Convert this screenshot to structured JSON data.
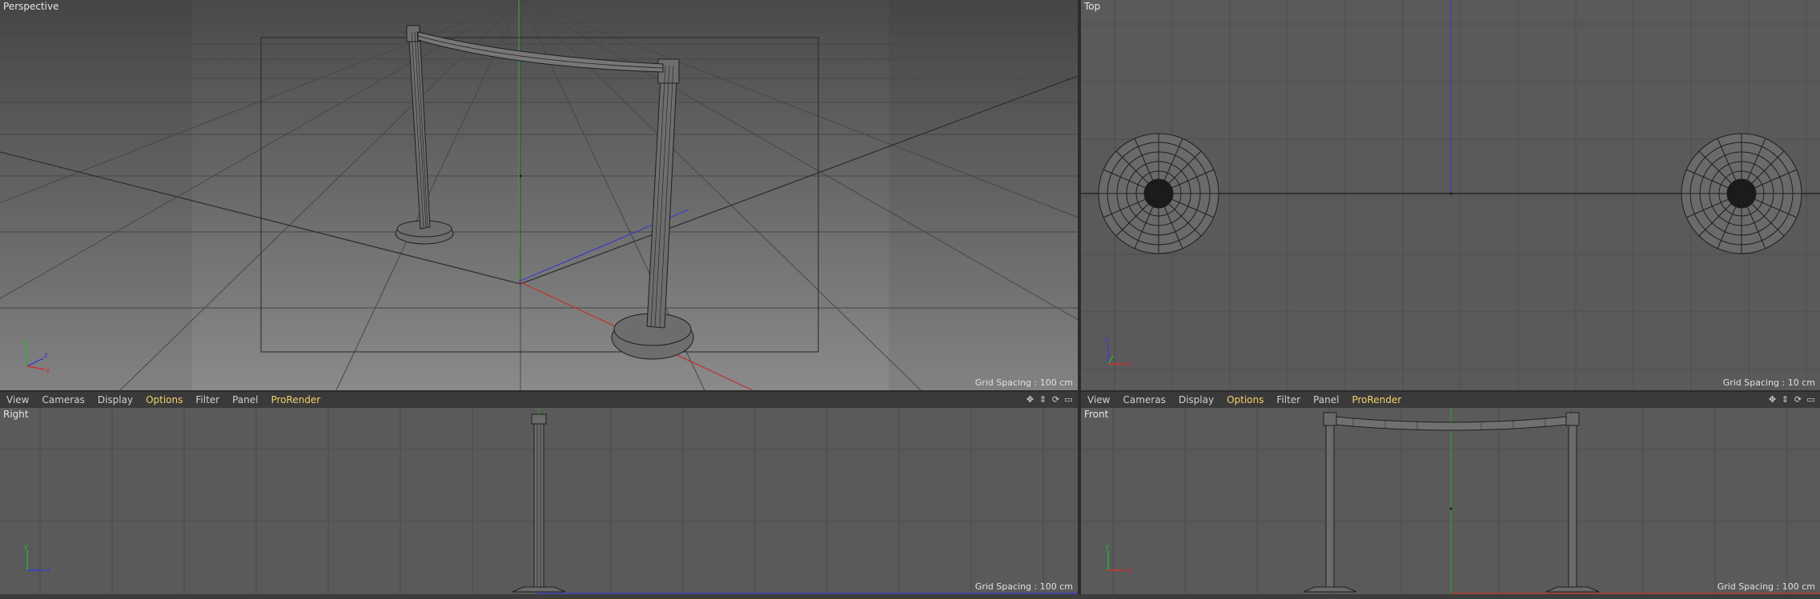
{
  "viewports": {
    "perspective": {
      "name": "Perspective",
      "grid_spacing": "Grid Spacing : 100 cm"
    },
    "top": {
      "name": "Top",
      "grid_spacing": "Grid Spacing : 10 cm"
    },
    "right": {
      "name": "Right",
      "grid_spacing": "Grid Spacing : 100 cm"
    },
    "front": {
      "name": "Front",
      "grid_spacing": "Grid Spacing : 100 cm"
    }
  },
  "menu_left": {
    "view": "View",
    "cameras": "Cameras",
    "display": "Display",
    "options": "Options",
    "filter": "Filter",
    "panel": "Panel",
    "prorender": "ProRender"
  },
  "menu_right": {
    "view": "View",
    "cameras": "Cameras",
    "display": "Display",
    "options": "Options",
    "filter": "Filter",
    "panel": "Panel",
    "prorender": "ProRender"
  },
  "nav_icons": [
    "move-view-icon",
    "scroll-view-icon",
    "rotate-view-icon",
    "toggle-view-icon"
  ],
  "colors": {
    "menu_highlight": "#f3d36a",
    "axis_x": "#d03030",
    "axis_y": "#30b030",
    "axis_z": "#3a3ad0",
    "viewport_bg": "#5a5a5a"
  }
}
